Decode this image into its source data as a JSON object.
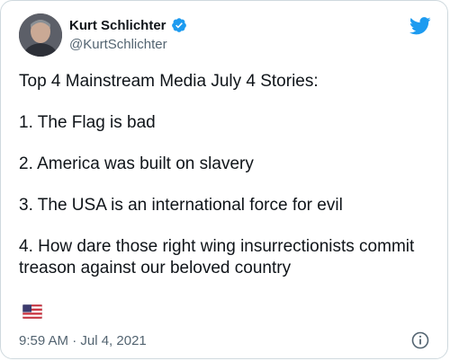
{
  "user": {
    "display_name": "Kurt Schlichter",
    "handle": "@KurtSchlichter"
  },
  "tweet": {
    "lines": [
      "Top 4 Mainstream Media July 4 Stories:",
      "1. The Flag is bad",
      "2. America was built on slavery",
      "3. The USA is an international force for evil",
      "4. How dare those right wing insurrectionists commit treason against our beloved country"
    ],
    "emoji": "us-flag-emoji",
    "timestamp": "9:59 AM · Jul 4, 2021"
  },
  "colors": {
    "twitter_blue": "#1d9bf0",
    "text": "#0f1419",
    "secondary_text": "#536471",
    "border": "#cfd9de"
  },
  "icons": {
    "verified": "verified-badge-icon",
    "logo": "twitter-bird-icon",
    "info": "info-circle-icon"
  }
}
